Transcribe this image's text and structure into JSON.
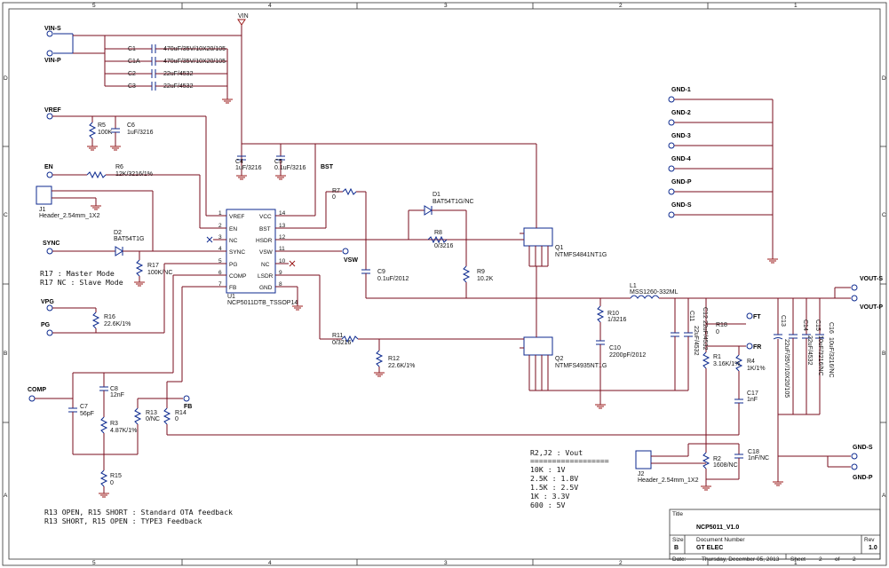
{
  "frame": {
    "top_cols": [
      "5",
      "4",
      "3",
      "2",
      "1"
    ],
    "bottom_cols": [
      "5",
      "4",
      "3",
      "2",
      "1"
    ],
    "rows": [
      "D",
      "C",
      "B",
      "A"
    ]
  },
  "nets": {
    "vin": "VIN",
    "vin_s": "VIN-S",
    "vin_p": "VIN-P",
    "vref": "VREF",
    "en": "EN",
    "sync": "SYNC",
    "vpg": "VPG",
    "pg": "PG",
    "comp": "COMP",
    "fb": "FB",
    "bst": "BST",
    "vsw": "VSW",
    "ft": "FT",
    "fr": "FR",
    "vout_s": "VOUT-S",
    "vout_p": "VOUT-P",
    "gnd_s": "GND-S",
    "gnd_p": "GND-P",
    "gnd_list": [
      "GND-1",
      "GND-2",
      "GND-3",
      "GND-4",
      "GND-P",
      "GND-S"
    ]
  },
  "parts": {
    "c1": "C1",
    "c1_val": "470uF/35V/10X20/105",
    "c1a": "C1A",
    "c1a_val": "470uF/35V/10X20/105",
    "c2": "C2",
    "c2_val": "22uF/4532",
    "c3": "C3",
    "c3_val": "22uF/4532",
    "r5": "R5",
    "r5_val": "100K",
    "c6": "C6",
    "c6_val": "1uF/3216",
    "c4": "C4",
    "c4_val": "1uF/3216",
    "c5": "C5",
    "c5_val": "0.1uF/3216",
    "r6": "R6",
    "r6_val": "12K/3216/1%",
    "j1": "J1",
    "j1_val": "Header_2.54mm_1X2",
    "d2": "D2",
    "d2_val": "BAT54T1G",
    "r17": "R17",
    "r17_val": "100K/NC",
    "r16": "R16",
    "r16_val": "22.6K/1%",
    "r7": "R7",
    "r7_val": "0",
    "d1": "D1",
    "d1_val": "BAT54T1G/NC",
    "r8": "R8",
    "r8_val": "0/3216",
    "c9": "C9",
    "c9_val": "0.1uF/2012",
    "r9": "R9",
    "r9_val": "10.2K",
    "q1": "Q1",
    "q1_val": "NTMFS4841NT1G",
    "q2": "Q2",
    "q2_val": "NTMFS4935NT1G",
    "u1": "U1",
    "u1_val": "NCP5011DTB_TSSOP14",
    "l1": "L1",
    "l1_val": "MSS1260-332ML",
    "r10": "R10",
    "r10_val": "1/3216",
    "c10": "C10",
    "c10_val": "2200pF/2012",
    "r11": "R11",
    "r11_val": "0/3216",
    "r12": "R12",
    "r12_val": "22.6K/1%",
    "c11": "C11",
    "c11_val": "22uF/4532",
    "c12": "C12",
    "c12_val": "22uF/4532",
    "r18": "R18",
    "r18_val": "0",
    "r1": "R1",
    "r1_val": "3.16K/1%",
    "r4": "R4",
    "r4_val": "1K/1%",
    "c17": "C17",
    "c17_val": "1nF",
    "c13": "C13",
    "c13_val": "22uF/35V/10X20/105",
    "c14": "C14",
    "c14_val": "22uF/4532",
    "c15": "C15",
    "c15_val": "10uF/3216/NC",
    "c16": "C16",
    "c16_val": "10uF/3216/NC",
    "c7": "C7",
    "c7_val": "56pF",
    "c8": "C8",
    "c8_val": "12nF",
    "r3": "R3",
    "r3_val": "4.87K/1%",
    "r13": "R13",
    "r13_val": "0/NC",
    "r14": "R14",
    "r14_val": "0",
    "r15": "R15",
    "r15_val": "0",
    "j2": "J2",
    "j2_val": "Header_2.54mm_1X2",
    "r2": "R2",
    "r2_val": "1608/NC",
    "c18": "C18",
    "c18_val": "1nF/NC"
  },
  "ic_pins": {
    "left": [
      "VREF",
      "EN",
      "NC",
      "SYNC",
      "PG",
      "COMP",
      "FB"
    ],
    "left_nums": [
      "1",
      "2",
      "3",
      "4",
      "5",
      "6",
      "7"
    ],
    "right": [
      "VCC",
      "BST",
      "HSDR",
      "VSW",
      "NC",
      "LSDR",
      "GND"
    ],
    "right_nums": [
      "14",
      "13",
      "12",
      "11",
      "10",
      "9",
      "8"
    ]
  },
  "notes": {
    "r17_master": "R17 : Master Mode",
    "r17_slave": "R17 NC : Slave Mode",
    "fb_note1": "R13 OPEN, R15 SHORT : Standard OTA feedback",
    "fb_note2": "R13 SHORT, R15 OPEN : TYPE3 Feedback"
  },
  "vout_table": {
    "header": "R2,J2  :  Vout",
    "rule": "==================",
    "rows": [
      "10K   :   1V",
      "2.5K  :   1.8V",
      "1.5K  :   2.5V",
      "1K    :   3.3V",
      "600   :   5V"
    ]
  },
  "title_block": {
    "title_label": "Title",
    "title": "NCP5011_V1.0",
    "size_label": "Size",
    "size": "B",
    "docnum_label": "Document Number",
    "docnum": "GT ELEC",
    "rev_label": "Rev",
    "rev": "1.0",
    "date_label": "Date:",
    "date": "Thursday, December 05, 2013",
    "sheet_label": "Sheet",
    "sheet": "2",
    "of_label": "of",
    "of": "2"
  }
}
